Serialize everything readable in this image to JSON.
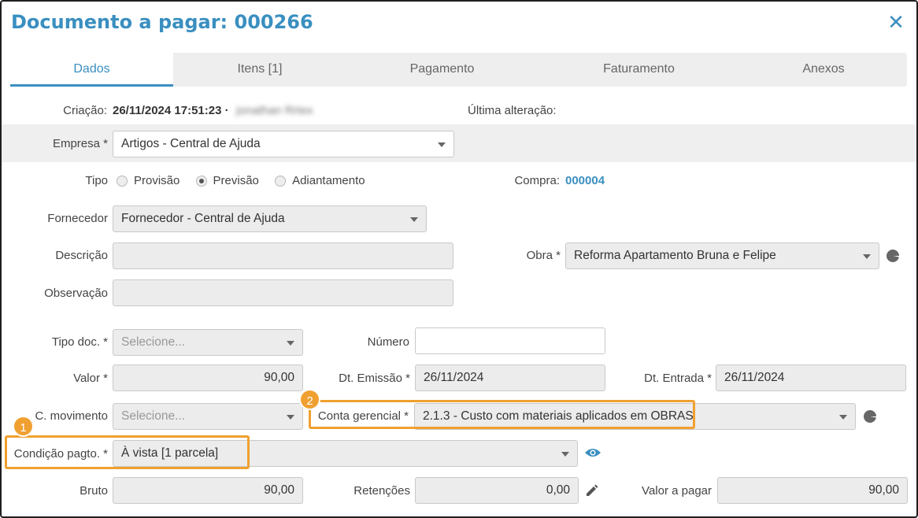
{
  "header": {
    "title": "Documento a pagar: 000266",
    "close_glyph": "✕"
  },
  "tabs": [
    {
      "label": "Dados",
      "active": true
    },
    {
      "label": "Itens [1]"
    },
    {
      "label": "Pagamento"
    },
    {
      "label": "Faturamento"
    },
    {
      "label": "Anexos"
    }
  ],
  "meta": {
    "created_label": "Criação:",
    "created_value": "26/11/2024 17:51:23 ·",
    "created_user": "jonathan Rrtex",
    "last_change_label": "Última alteração:"
  },
  "form": {
    "empresa": {
      "label": "Empresa *",
      "value": "Artigos - Central de Ajuda"
    },
    "tipo": {
      "label": "Tipo",
      "options": [
        "Provisão",
        "Previsão",
        "Adiantamento"
      ],
      "selected": "Previsão"
    },
    "compra": {
      "label": "Compra:",
      "value": "000004"
    },
    "fornecedor": {
      "label": "Fornecedor",
      "value": "Fornecedor - Central de Ajuda"
    },
    "descricao": {
      "label": "Descrição",
      "value": ""
    },
    "obra": {
      "label": "Obra *",
      "value": "Reforma Apartamento Bruna e Felipe"
    },
    "observacao": {
      "label": "Observação",
      "value": ""
    },
    "tipo_doc": {
      "label": "Tipo doc. *",
      "placeholder": "Selecione..."
    },
    "numero": {
      "label": "Número",
      "value": ""
    },
    "valor": {
      "label": "Valor *",
      "value": "90,00"
    },
    "dt_emissao": {
      "label": "Dt. Emissão *",
      "value": "26/11/2024"
    },
    "dt_entrada": {
      "label": "Dt. Entrada *",
      "value": "26/11/2024"
    },
    "c_movimento": {
      "label": "C. movimento",
      "placeholder": "Selecione..."
    },
    "conta_gerencial": {
      "label": "Conta gerencial *",
      "value": "2.1.3 - Custo com materiais aplicados em OBRAS"
    },
    "condicao_pagto": {
      "label": "Condição pagto. *",
      "value": "À vista [1 parcela]"
    },
    "bruto": {
      "label": "Bruto",
      "value": "90,00"
    },
    "retencoes": {
      "label": "Retenções",
      "value": "0,00"
    },
    "valor_a_pagar": {
      "label": "Valor a pagar",
      "value": "90,00"
    }
  },
  "annotations": {
    "badge_1": "1",
    "badge_2": "2"
  },
  "icons": {
    "eye": "eye-icon",
    "pencil": "pencil-icon",
    "pie": "pie-chart-icon"
  },
  "colors": {
    "accent": "#3a8fc0",
    "highlight": "#f0a030"
  }
}
